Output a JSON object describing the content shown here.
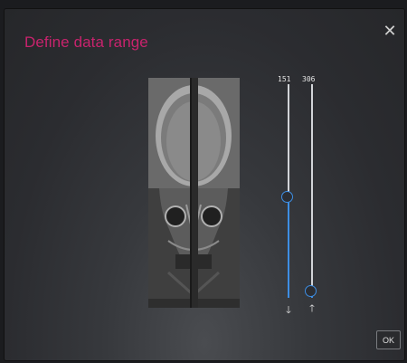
{
  "dialog": {
    "title": "Define data range",
    "close_icon": "close-icon",
    "ok_label": "OK"
  },
  "preview": {
    "image": "ct-skull-coronal-slice"
  },
  "sliders": {
    "lower": {
      "value_label": "151",
      "arrow_icon": "arrow-down-icon",
      "level": 0.47
    },
    "upper": {
      "value_label": "306",
      "arrow_icon": "arrow-up-icon",
      "level": 0.03
    }
  },
  "colors": {
    "title": "#c8236d",
    "slider_accent": "#3d8ee4",
    "track": "#d2d4d8"
  }
}
